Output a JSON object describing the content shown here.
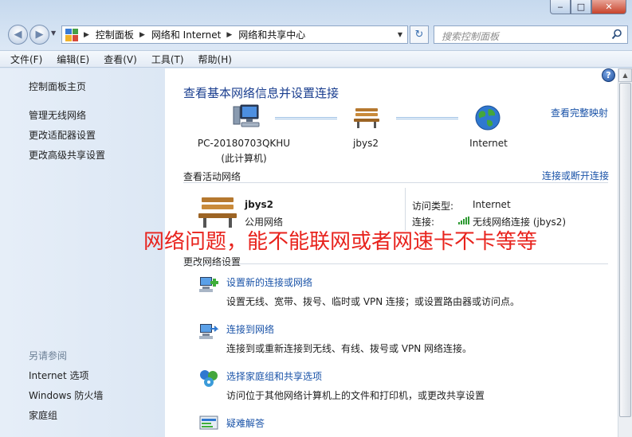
{
  "window": {
    "controls": {
      "minimize": "‒",
      "maximize": "□",
      "close": "✕"
    }
  },
  "nav": {
    "breadcrumbs": [
      "控制面板",
      "网络和 Internet",
      "网络和共享中心"
    ],
    "search_placeholder": "搜索控制面板"
  },
  "menubar": [
    "文件(F)",
    "编辑(E)",
    "查看(V)",
    "工具(T)",
    "帮助(H)"
  ],
  "sidebar": {
    "home": "控制面板主页",
    "items": [
      "管理无线网络",
      "更改适配器设置",
      "更改高级共享设置"
    ],
    "see_also_header": "另请参阅",
    "see_also": [
      "Internet 选项",
      "Windows 防火墙",
      "家庭组"
    ]
  },
  "main": {
    "title": "查看基本网络信息并设置连接",
    "full_map_link": "查看完整映射",
    "nodes": {
      "computer_name": "PC-20180703QKHU",
      "computer_sub": "(此计算机)",
      "network": "jbys2",
      "internet": "Internet"
    },
    "active_networks": {
      "header": "查看活动网络",
      "toggle_link": "连接或断开连接",
      "name": "jbys2",
      "type": "公用网络",
      "access_label": "访问类型:",
      "access_value": "Internet",
      "connection_label": "连接:",
      "connection_value": "无线网络连接 (jbys2)"
    },
    "change_settings": {
      "header": "更改网络设置",
      "tasks": [
        {
          "title": "设置新的连接或网络",
          "desc": "设置无线、宽带、拨号、临时或 VPN 连接；或设置路由器或访问点。"
        },
        {
          "title": "连接到网络",
          "desc": "连接到或重新连接到无线、有线、拨号或 VPN 网络连接。"
        },
        {
          "title": "选择家庭组和共享选项",
          "desc": "访问位于其他网络计算机上的文件和打印机，或更改共享设置"
        },
        {
          "title": "疑难解答",
          "desc": ""
        }
      ]
    }
  },
  "overlay_text": "网络问题，能不能联网或者网速卡不卡等等",
  "colors": {
    "link": "#1a53a8",
    "title": "#1a3e8f",
    "overlay": "#e8231d"
  }
}
